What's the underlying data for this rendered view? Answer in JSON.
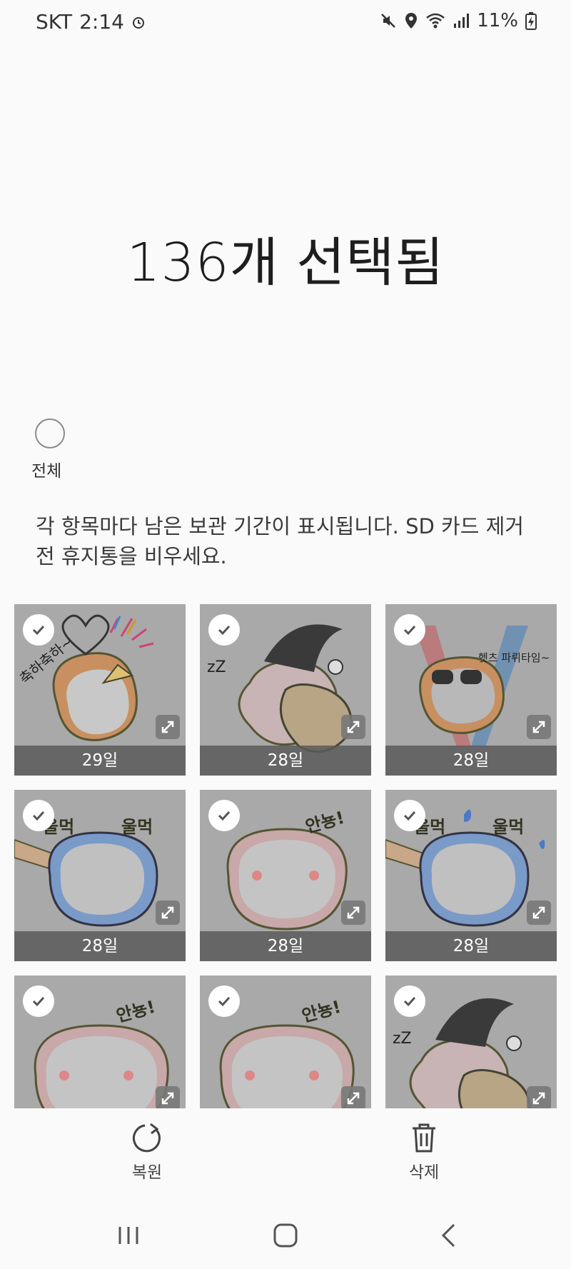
{
  "status_bar": {
    "carrier": "SKT",
    "time": "2:14",
    "battery": "11%",
    "icons": [
      "alarm-icon",
      "mute-icon",
      "location-icon",
      "wifi-icon",
      "signal-icon",
      "battery-charging-icon"
    ]
  },
  "header": {
    "title": "136개 선택됨"
  },
  "select_all": {
    "label": "전체",
    "checked": false
  },
  "notice": "각 항목마다 남은 보관 기간이 표시됩니다. SD 카드 제거 전 휴지통을 비우세요.",
  "items": [
    {
      "days": "29일",
      "selected": true,
      "overlay_text": "축하축하~"
    },
    {
      "days": "28일",
      "selected": true,
      "overlay_text": ""
    },
    {
      "days": "28일",
      "selected": true,
      "overlay_text": "헷츠 파뤼타임~"
    },
    {
      "days": "28일",
      "selected": true,
      "overlay_text": "울먹 울먹"
    },
    {
      "days": "28일",
      "selected": true,
      "overlay_text": "안뇽!"
    },
    {
      "days": "28일",
      "selected": true,
      "overlay_text": "울먹 울먹"
    },
    {
      "days": "",
      "selected": true,
      "overlay_text": "안뇽!"
    },
    {
      "days": "",
      "selected": true,
      "overlay_text": "안뇽!"
    },
    {
      "days": "",
      "selected": true,
      "overlay_text": ""
    }
  ],
  "actions": {
    "restore": "복원",
    "delete": "삭제"
  },
  "nav": [
    "recent-apps",
    "home",
    "back"
  ]
}
